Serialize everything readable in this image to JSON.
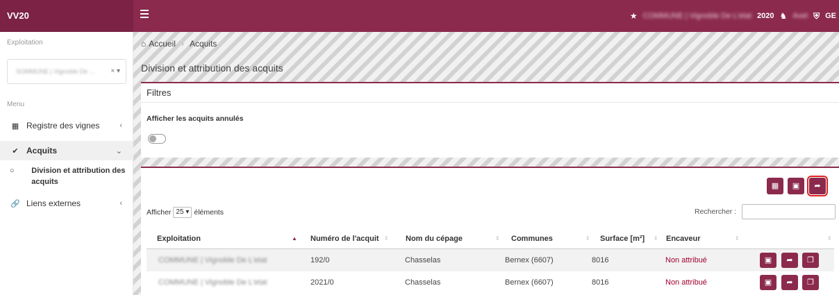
{
  "app": {
    "brand": "VV20"
  },
  "topbar": {
    "company_blurred": "COMMUNE | Vignoble De L'etat",
    "year": "2020",
    "user_blurred": "Avet",
    "lang": "GE"
  },
  "sidebar": {
    "exploitation_label": "Exploitation",
    "exploitation_value_blurred": "SOMMUNE | Vignoble De ...",
    "menu_label": "Menu",
    "items": [
      {
        "label": "Registre des vignes",
        "icon": "map-icon"
      },
      {
        "label": "Acquits",
        "icon": "check-circle-icon"
      },
      {
        "label": "Liens externes",
        "icon": "link-icon"
      }
    ],
    "sub_item": "Division et attribution des acquits"
  },
  "breadcrumb": {
    "home": "Accueil",
    "current": "Acquits"
  },
  "page": {
    "title": "Division et attribution des acquits"
  },
  "filters": {
    "title": "Filtres",
    "show_cancelled_label": "Afficher les acquits annulés",
    "show_cancelled": false
  },
  "table": {
    "length_prefix": "Afficher",
    "length_value": "25",
    "length_suffix": "éléments",
    "search_label": "Rechercher :",
    "search_value": "",
    "headers": [
      "Exploitation",
      "Numéro de l'acquit",
      "Nom du cépage",
      "Communes",
      "Surface [m²]",
      "Encaveur"
    ],
    "rows": [
      {
        "exploitation": "COMMUNE | Vignoble De L'etat",
        "numero": "192/0",
        "cepage": "Chasselas",
        "commune": "Bernex (6607)",
        "surface": "8016",
        "encaveur": "Non attribué"
      },
      {
        "exploitation": "COMMUNE | Vignoble De L'etat",
        "numero": "2021/0",
        "cepage": "Chasselas",
        "commune": "Bernex (6607)",
        "surface": "8016",
        "encaveur": "Non attribué"
      }
    ]
  },
  "colors": {
    "brand": "#8b2a4d",
    "brand_dark": "#7b2245",
    "highlight": "#e02020",
    "not_assigned": "#a0002f"
  }
}
